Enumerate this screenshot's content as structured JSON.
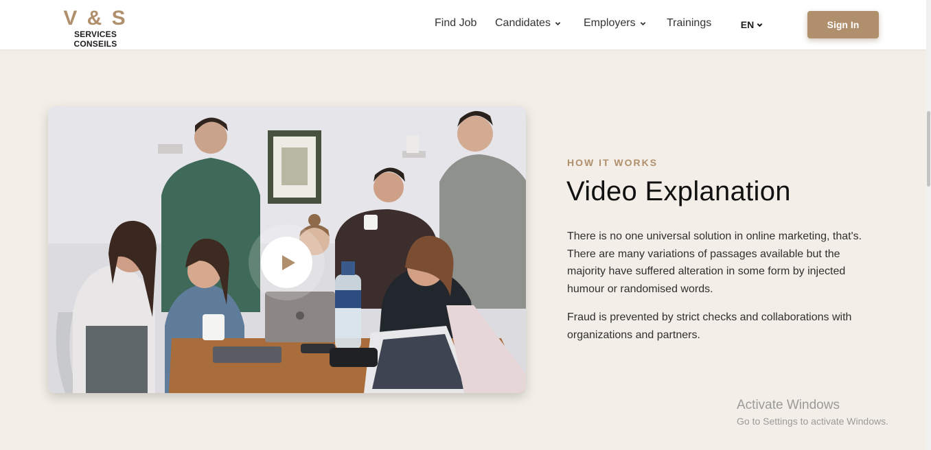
{
  "brand": {
    "mark": "V & S",
    "subtitle": "SERVICES CONSEILS",
    "accent_color": "#b08f6c"
  },
  "nav": {
    "items": [
      {
        "label": "Find Job",
        "has_dropdown": false
      },
      {
        "label": "Candidates",
        "has_dropdown": true
      },
      {
        "label": "Employers",
        "has_dropdown": true
      },
      {
        "label": "Trainings",
        "has_dropdown": false
      }
    ],
    "language": "EN",
    "sign_in": "Sign In"
  },
  "video": {
    "play_icon": "play-icon",
    "thumbnail": "team-meeting-photo"
  },
  "section": {
    "eyebrow": "HOW IT WORKS",
    "title": "Video Explanation",
    "paragraphs": [
      "There is no one universal solution in online marketing, that's. There are many variations of passages available but the majority have suffered alteration in some form by injected humour or randomised words.",
      "Fraud is prevented by strict checks and collaborations with organizations and partners."
    ]
  },
  "watermark": {
    "title": "Activate Windows",
    "subtitle": "Go to Settings to activate Windows."
  }
}
